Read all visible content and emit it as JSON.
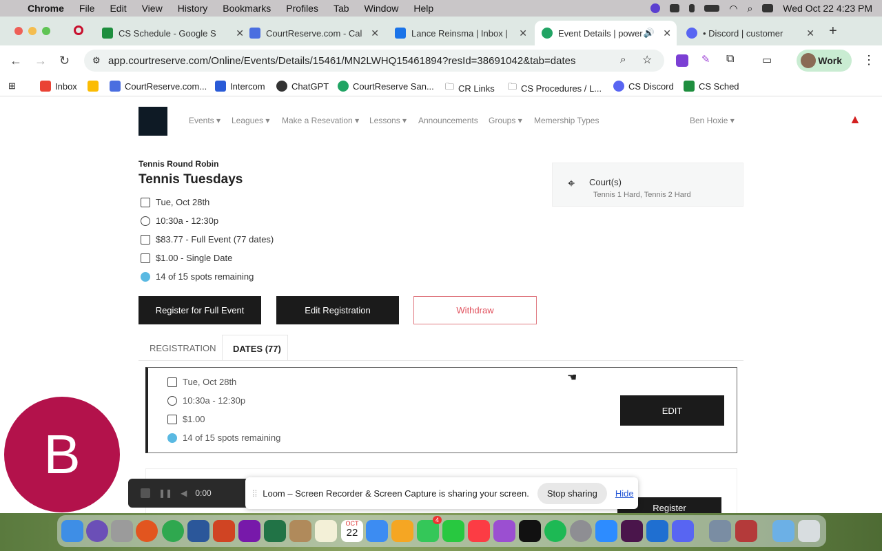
{
  "menubar": {
    "app": "Chrome",
    "items": [
      "File",
      "Edit",
      "View",
      "History",
      "Bookmarks",
      "Profiles",
      "Tab",
      "Window",
      "Help"
    ],
    "datetime": "Wed Oct 22  4:23 PM"
  },
  "tabs": [
    {
      "label": "CS Schedule - Google S",
      "color": "#1e8e3e"
    },
    {
      "label": "CourtReserve.com - Cal",
      "color": "#4a6ee0"
    },
    {
      "label": "Lance Reinsma | Inbox |",
      "color": "#1a73e8"
    },
    {
      "label": "Event Details | power",
      "color": "#21a464"
    },
    {
      "label": "• Discord | customer",
      "color": "#5865f2"
    }
  ],
  "address": {
    "url": "app.courtreserve.com/Online/Events/Details/15461/MN2LWHQ15461894?resId=38691042&tab=dates",
    "profile": "Work"
  },
  "bookmarks": [
    "Inbox",
    "CourtReserve.com...",
    "Intercom",
    "ChatGPT",
    "CourtReserve San...",
    "CR Links",
    "CS Procedures / L...",
    "CS Discord",
    "CS Sched"
  ],
  "nav": {
    "items": [
      "Events",
      "Leagues",
      "Make a Resevation",
      "Lessons",
      "Announcements",
      "Groups",
      "Memership Types"
    ],
    "user": "Ben Hoxie"
  },
  "event": {
    "type": "Tennis Round Robin",
    "title": "Tennis Tuesdays",
    "date": "Tue, Oct 28th",
    "time": "10:30a - 12:30p",
    "price_full": "$83.77 - Full Event (77 dates)",
    "price_single": "$1.00 - Single Date",
    "spots": "14 of 15 spots remaining"
  },
  "buttons": {
    "register_full": "Register for Full Event",
    "edit_registration": "Edit Registration",
    "withdraw": "Withdraw"
  },
  "court": {
    "label": "Court(s)",
    "value": "Tennis 1 Hard, Tennis 2 Hard"
  },
  "page_tabs": {
    "registration": "REGISTRATION",
    "dates": "DATES (77)"
  },
  "date_card": {
    "date": "Tue, Oct 28th",
    "time": "10:30a - 12:30p",
    "price": "$1.00",
    "spots": "14 of 15 spots remaining",
    "edit": "EDIT"
  },
  "next_card": {
    "register": "Register"
  },
  "loom": {
    "time": "0:00",
    "message": "Loom – Screen Recorder & Screen Capture is sharing your screen.",
    "stop": "Stop sharing",
    "hide": "Hide"
  },
  "avatar": {
    "letter": "B"
  },
  "dock": {
    "calendar_month": "OCT",
    "calendar_day": "22",
    "badge": "4"
  }
}
